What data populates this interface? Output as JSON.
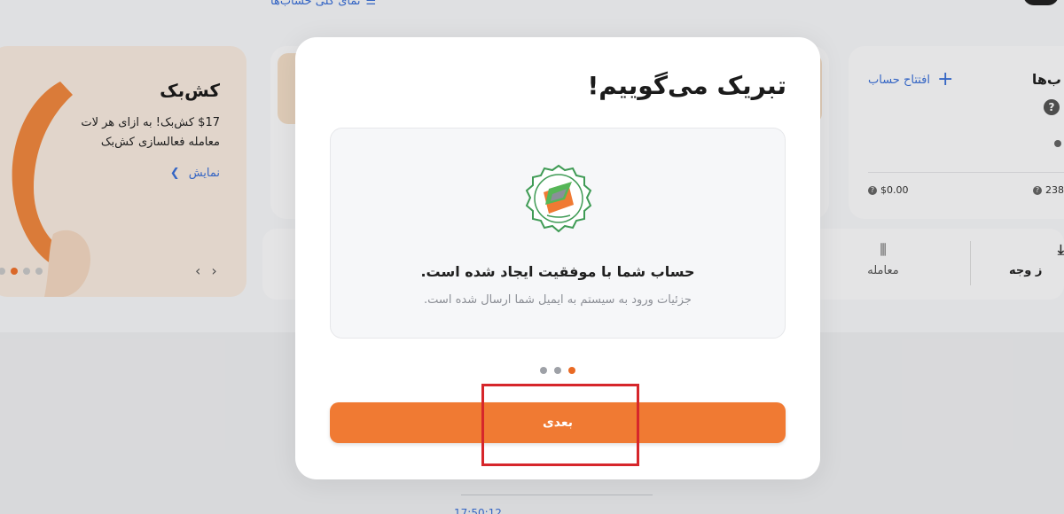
{
  "background": {
    "top_link": "نمای کلی حساب‌ها",
    "cashback": {
      "title": "کش‌بک",
      "line1": "$17 کش‌بک! به ازای هر لات",
      "line2": "معامله فعالسازی کش‌بک",
      "show_label": "نمایش"
    },
    "accounts": {
      "title_partial": "ب‌ها",
      "open_account": "افتتاح حساب",
      "balance_left": "$0.00",
      "balance_right": "238"
    },
    "actions": {
      "trade": "معامله",
      "deposit_partial": "ز وجه"
    },
    "bottom_time": "17:50:12"
  },
  "modal": {
    "title": "تبریک می‌گوییم!",
    "success_text": "حساب شما با موفقیت ایجاد شده است.",
    "details_text": "جزئیات ورود به سیستم به ایمیل شما ارسال شده است.",
    "steps": {
      "count": 3,
      "active_index": 2
    },
    "next_button": "بعدی",
    "seal_icon": "success-seal-icon"
  },
  "colors": {
    "accent": "#f07a33",
    "link": "#3a6fd8",
    "highlight_box": "#d6262b"
  }
}
